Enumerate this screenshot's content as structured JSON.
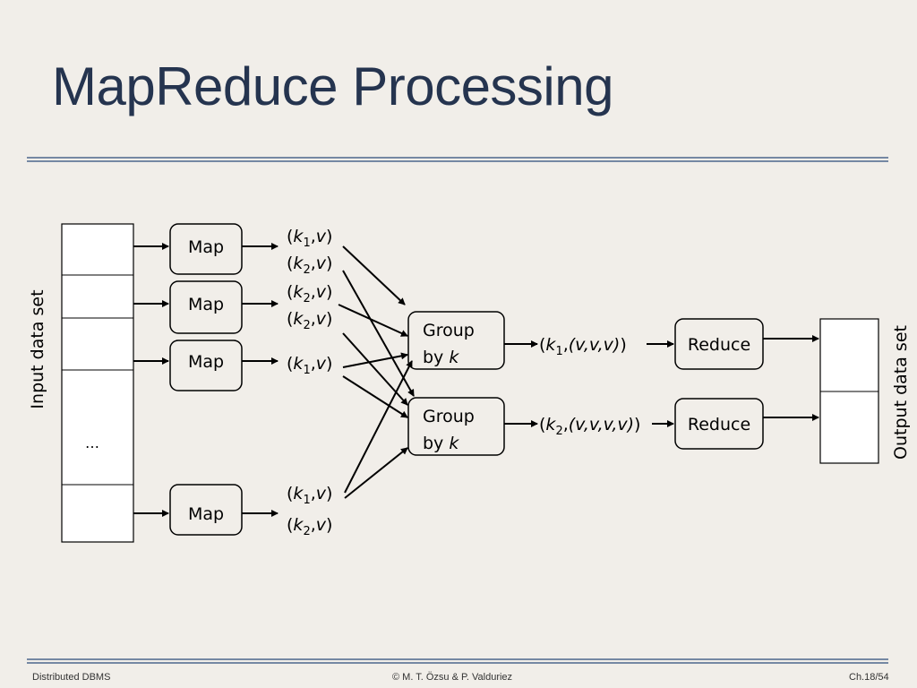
{
  "title": "MapReduce Processing",
  "input_label": "Input data set",
  "output_label": "Output data set",
  "ellipsis": "…",
  "map_label": "Map",
  "group": {
    "line1": "Group",
    "line2": "by",
    "var": "k"
  },
  "reduce_label": "Reduce",
  "map_outputs": [
    [
      {
        "k": "k",
        "i": "1",
        "v": "v"
      },
      {
        "k": "k",
        "i": "2",
        "v": "v"
      }
    ],
    [
      {
        "k": "k",
        "i": "2",
        "v": "v"
      },
      {
        "k": "k",
        "i": "2",
        "v": "v"
      }
    ],
    [
      {
        "k": "k",
        "i": "1",
        "v": "v"
      }
    ],
    [
      {
        "k": "k",
        "i": "1",
        "v": "v"
      },
      {
        "k": "k",
        "i": "2",
        "v": "v"
      }
    ]
  ],
  "grouped": [
    {
      "k": "k",
      "i": "1",
      "values": "(v,v,v)"
    },
    {
      "k": "k",
      "i": "2",
      "values": "(v,v,v,v)"
    }
  ],
  "footer": {
    "left": "Distributed DBMS",
    "center": "© M. T. Özsu & P. Valduriez",
    "right": "Ch.18/54"
  },
  "colors": {
    "title": "#25344f",
    "rule": "#7588a3",
    "background": "#f1eee9"
  }
}
